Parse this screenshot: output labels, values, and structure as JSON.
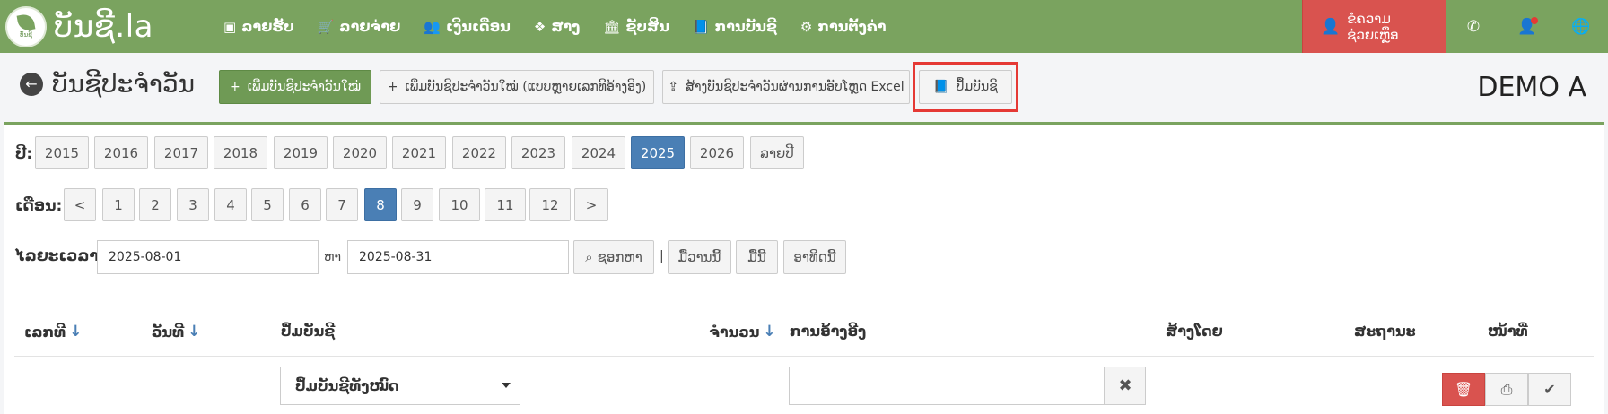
{
  "brand": {
    "name": "ບັນຊີ.la",
    "logo_small": "ບັນຊີ"
  },
  "nav": [
    {
      "label": "ລາຍຮັບ",
      "icon": "money-icon",
      "glyph": "▣"
    },
    {
      "label": "ລາຍຈ່າຍ",
      "icon": "cart-icon",
      "glyph": "🛒"
    },
    {
      "label": "ເງິນເດືອນ",
      "icon": "users-icon",
      "glyph": "👥"
    },
    {
      "label": "ສາງ",
      "icon": "dropbox-icon",
      "glyph": "❖"
    },
    {
      "label": "ຊັບສິນ",
      "icon": "bank-icon",
      "glyph": "🏛"
    },
    {
      "label": "ການບັນຊີ",
      "icon": "book-icon",
      "glyph": "📘"
    },
    {
      "label": "ການຕັ້ງຄ່າ",
      "icon": "cogs-icon",
      "glyph": "⚙"
    }
  ],
  "nav_right": {
    "help_label": "ຂໍຄວາມຊ່ວຍເຫຼືອ"
  },
  "page": {
    "title": "ບັນຊີປະຈໍາວັນ",
    "company": "DEMO A",
    "buttons": {
      "new_journal": "ເພີ່ມບັນຊີປະຈໍາວັນໃໝ່",
      "new_journal_multi": "ເພີ່ມບັນຊີປະຈໍາວັນໃໝ່ (ແບບຫຼາຍເລກທີອ້າງອີງ)",
      "import_excel": "ສ້າງບັນຊີປະຈໍາວັນຜ່ານການອັບໂຫຼດ Excel",
      "ledger": "ປຶ້ມບັນຊີ"
    }
  },
  "filters": {
    "year_label": "ປີ:",
    "years": [
      "2015",
      "2016",
      "2017",
      "2018",
      "2019",
      "2020",
      "2021",
      "2022",
      "2023",
      "2024",
      "2025",
      "2026",
      "ລາຍປີ"
    ],
    "selected_year": "2025",
    "month_label": "ເດືອນ:",
    "months": [
      "<",
      "1",
      "2",
      "3",
      "4",
      "5",
      "6",
      "7",
      "8",
      "9",
      "10",
      "11",
      "12",
      ">"
    ],
    "selected_month": "8",
    "period_label": "ໄລຍະເວລາ:",
    "date_from": "2025-08-01",
    "to_label": "ຫາ",
    "date_to": "2025-08-31",
    "search_label": "ຊອກຫາ",
    "separator": "|",
    "yesterday": "ມື້ວານນີ້",
    "today": "ມື້ນີ້",
    "this_week": "ອາທິດນີ້"
  },
  "table": {
    "headers": {
      "number": "ເລກທີ",
      "date": "ວັນທີ",
      "ledger": "ປຶ້ມບັນຊີ",
      "amount": "ຈໍານວນ",
      "reference": "ການອ້າງອີງ",
      "created_by": "ສ້າງໂດຍ",
      "status": "ສະຖານະ",
      "actions": "ໜ້າທີ່"
    },
    "ledger_filter_value": "ປຶ້ມບັນຊີທັງໝົດ",
    "reference_filter_value": ""
  },
  "colors": {
    "brand_green": "#7aa35f",
    "danger_red": "#d9534f",
    "active_blue": "#4a7fb5"
  }
}
